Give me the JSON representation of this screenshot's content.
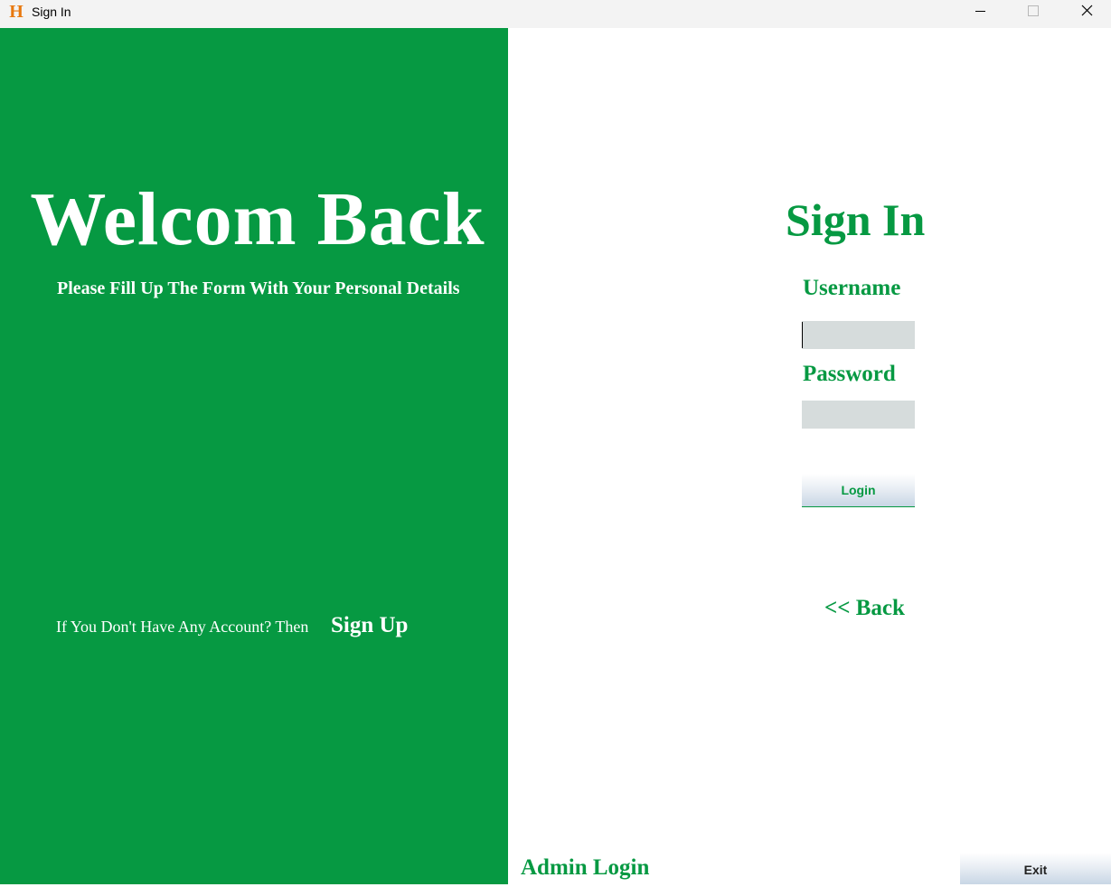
{
  "window": {
    "title": "Sign In",
    "app_icon_glyph": "H",
    "app_icon": "h-app-icon",
    "icon_color": "#e8780e"
  },
  "left_panel": {
    "heading": "Welcom Back",
    "subtitle": "Please Fill Up The Form With Your Personal Details",
    "signup_prompt": "If You Don't Have Any Account? Then",
    "signup_link": "Sign Up",
    "background": "#069942"
  },
  "form": {
    "heading": "Sign In",
    "username_label": "Username",
    "username_value": "",
    "password_label": "Password",
    "password_value": "",
    "login_label": "Login",
    "back_label": "<< Back",
    "accent": "#069942"
  },
  "footer": {
    "admin_login_label": "Admin Login",
    "exit_label": "Exit"
  }
}
